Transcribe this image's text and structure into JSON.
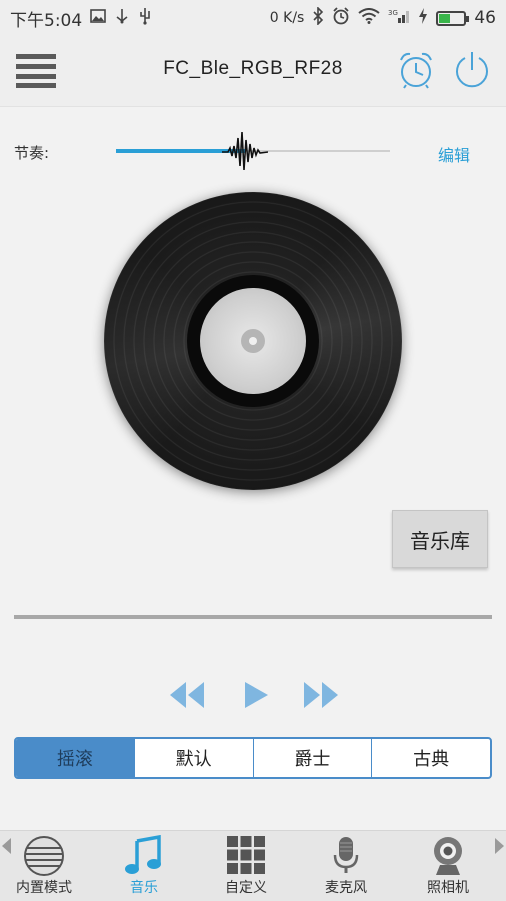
{
  "status": {
    "time": "下午5:04",
    "speed": "0 K/s",
    "signal_label": "3G",
    "battery": "46",
    "battery_level": 0.46,
    "left_icons": [
      "image-icon",
      "usb-icon",
      "usb-debug-icon"
    ],
    "right_icons": [
      "bluetooth-icon",
      "alarm-icon",
      "wifi-icon",
      "signal-icon",
      "charging-icon",
      "battery-icon"
    ]
  },
  "header": {
    "title": "FC_Ble_RGB_RF28",
    "icons": [
      "menu-list-icon",
      "alarm-clock-icon",
      "power-icon"
    ]
  },
  "rhythm": {
    "label": "节奏:",
    "edit_label": "编辑",
    "level": 0.47
  },
  "library_button": "音乐库",
  "playback_progress": 0,
  "transport": [
    "previous-icon",
    "play-icon",
    "next-icon"
  ],
  "presets": {
    "selected": "摇滚",
    "items": [
      "摇滚",
      "默认",
      "爵士",
      "古典"
    ]
  },
  "bottom_nav": {
    "items": [
      {
        "label": "内置模式",
        "icon": "builtin-mode-icon"
      },
      {
        "label": "音乐",
        "icon": "music-note-icon"
      },
      {
        "label": "自定义",
        "icon": "grid-icon"
      },
      {
        "label": "麦克风",
        "icon": "microphone-icon"
      },
      {
        "label": "照相机",
        "icon": "webcam-icon"
      }
    ],
    "active": "音乐"
  },
  "colors": {
    "accent": "#2a9fd6",
    "segment_active": "#4a8cc9",
    "charging": "#39b54a"
  }
}
